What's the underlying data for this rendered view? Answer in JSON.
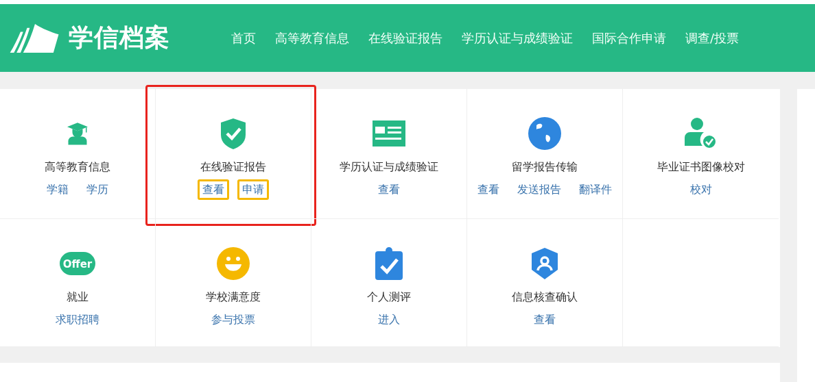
{
  "header": {
    "logo_text": "学信档案",
    "nav": [
      {
        "label": "首页"
      },
      {
        "label": "高等教育信息"
      },
      {
        "label": "在线验证报告"
      },
      {
        "label": "学历认证与成绩验证"
      },
      {
        "label": "国际合作申请"
      },
      {
        "label": "调查/投票"
      }
    ]
  },
  "tiles": [
    {
      "title": "高等教育信息",
      "highlighted": false,
      "links": [
        {
          "label": "学籍",
          "highlighted": false
        },
        {
          "label": "学历",
          "highlighted": false
        }
      ]
    },
    {
      "title": "在线验证报告",
      "highlighted": true,
      "links": [
        {
          "label": "查看",
          "highlighted": true
        },
        {
          "label": "申请",
          "highlighted": true
        }
      ]
    },
    {
      "title": "学历认证与成绩验证",
      "highlighted": false,
      "links": [
        {
          "label": "查看",
          "highlighted": false
        }
      ]
    },
    {
      "title": "留学报告传输",
      "highlighted": false,
      "links": [
        {
          "label": "查看",
          "highlighted": false
        },
        {
          "label": "发送报告",
          "highlighted": false
        },
        {
          "label": "翻译件",
          "highlighted": false
        }
      ]
    },
    {
      "title": "毕业证书图像校对",
      "highlighted": false,
      "links": [
        {
          "label": "校对",
          "highlighted": false
        }
      ]
    },
    {
      "title": "就业",
      "icon_text": "Offer",
      "highlighted": false,
      "links": [
        {
          "label": "求职招聘",
          "highlighted": false
        }
      ]
    },
    {
      "title": "学校满意度",
      "highlighted": false,
      "links": [
        {
          "label": "参与投票",
          "highlighted": false
        }
      ]
    },
    {
      "title": "个人测评",
      "highlighted": false,
      "links": [
        {
          "label": "进入",
          "highlighted": false
        }
      ]
    },
    {
      "title": "信息核查确认",
      "highlighted": false,
      "links": [
        {
          "label": "查看",
          "highlighted": false
        }
      ]
    }
  ]
}
